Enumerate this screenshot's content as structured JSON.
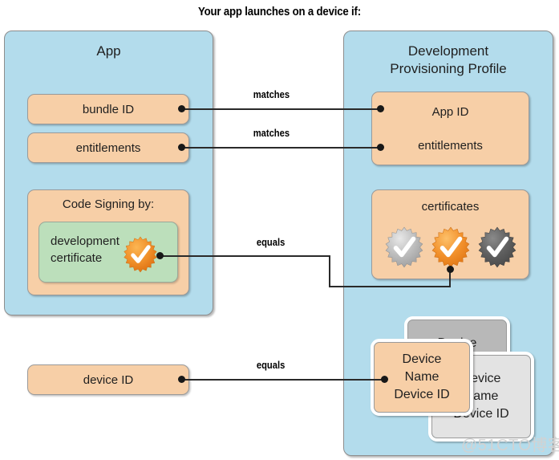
{
  "title": "Your app launches on a device if:",
  "panels": {
    "app": {
      "label": "App"
    },
    "profile": {
      "label_line1": "Development",
      "label_line2": "Provisioning Profile"
    }
  },
  "app_items": {
    "bundle_id": "bundle ID",
    "entitlements": "entitlements",
    "code_signing_label": "Code Signing by:",
    "certificate_line1": "development",
    "certificate_line2": "certificate"
  },
  "profile_items": {
    "app_id": "App ID",
    "entitlements": "entitlements",
    "certificates_label": "certificates"
  },
  "device_id_box": "device ID",
  "devices": {
    "back": {
      "line1": "Device",
      "line2": "Name",
      "line3": "Device ID"
    },
    "mid": {
      "line1": "Device",
      "line2": "Name",
      "line3": "Device ID"
    },
    "front": {
      "line1": "Device",
      "line2": "Name",
      "line3": "Device ID"
    }
  },
  "connectors": {
    "bundle_to_appid": "matches",
    "entitlements_to_entitlements": "matches",
    "certificate_to_certificates": "equals",
    "deviceid_to_device": "equals"
  },
  "seals": {
    "development_certificate": "check-seal-orange",
    "cert_left": "check-seal-silver",
    "cert_middle": "check-seal-orange",
    "cert_right": "check-seal-dark"
  },
  "watermark": "@51CTO博客",
  "colors": {
    "panel_blue": "#b3dcec",
    "box_orange": "#f7cfa7",
    "box_green": "#bcdfbb",
    "seal_orange": "#f0902a",
    "seal_silver": "#b9b9b9",
    "seal_dark": "#5b5b5b",
    "line": "#2a2a2a"
  }
}
